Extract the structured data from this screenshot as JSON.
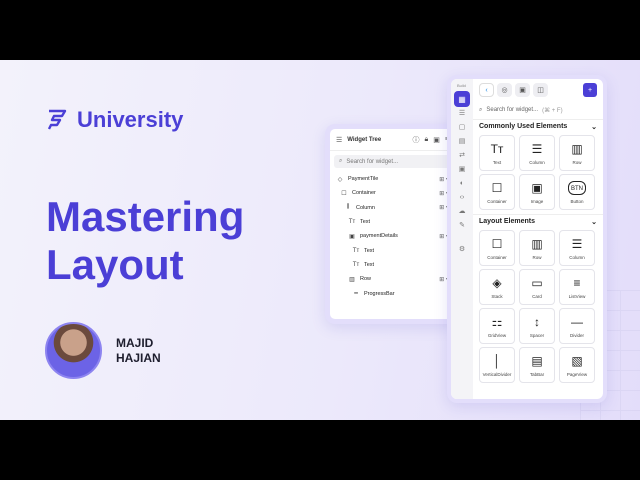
{
  "brand": {
    "name": "University",
    "logo": "university-logo"
  },
  "title": {
    "line1": "Mastering",
    "line2": "Layout"
  },
  "author": {
    "first": "MAJID",
    "last": "HAJIAN"
  },
  "colors": {
    "accent": "#4b3fd6",
    "background": "#ece9fb"
  },
  "tree": {
    "title": "Widget Tree",
    "search_placeholder": "Search for widget...",
    "rows": [
      {
        "label": "PaymentTile",
        "icon": "component-icon",
        "indent": 0,
        "action": true
      },
      {
        "label": "Container",
        "icon": "square-icon",
        "indent": 1,
        "action": true
      },
      {
        "label": "Column",
        "icon": "column-icon",
        "indent": 2,
        "action": true
      },
      {
        "label": "Text",
        "icon": "text-icon",
        "indent": 3,
        "action": false
      },
      {
        "label": "paymentDetails",
        "icon": "image-icon",
        "indent": 3,
        "action": true
      },
      {
        "label": "Text",
        "icon": "text-icon",
        "indent": 4,
        "action": false
      },
      {
        "label": "Text",
        "icon": "text-icon",
        "indent": 4,
        "action": false
      },
      {
        "label": "Row",
        "icon": "row-icon",
        "indent": 3,
        "action": true
      },
      {
        "label": "ProgressBar",
        "icon": "progress-icon",
        "indent": 4,
        "action": false
      }
    ]
  },
  "widgets": {
    "rail_label": "Build",
    "search_placeholder": "Search for widget...",
    "search_shortcut": "(⌘ + F)",
    "sections": [
      {
        "title": "Commonly Used Elements",
        "items": [
          {
            "label": "Text",
            "glyph": "Tт"
          },
          {
            "label": "Column",
            "glyph": "☰"
          },
          {
            "label": "Row",
            "glyph": "▥"
          },
          {
            "label": "Container",
            "glyph": "☐"
          },
          {
            "label": "Image",
            "glyph": "▣"
          },
          {
            "label": "Button",
            "glyph": "BTN"
          }
        ]
      },
      {
        "title": "Layout Elements",
        "items": [
          {
            "label": "Container",
            "glyph": "☐"
          },
          {
            "label": "Row",
            "glyph": "▥"
          },
          {
            "label": "Column",
            "glyph": "☰"
          },
          {
            "label": "Stack",
            "glyph": "◈"
          },
          {
            "label": "Card",
            "glyph": "▭"
          },
          {
            "label": "ListView",
            "glyph": "≡"
          },
          {
            "label": "GridView",
            "glyph": "⚏"
          },
          {
            "label": "Spacer",
            "glyph": "↕"
          },
          {
            "label": "Divider",
            "glyph": "—"
          },
          {
            "label": "VerticalDivider",
            "glyph": "│"
          },
          {
            "label": "TabBar",
            "glyph": "▤"
          },
          {
            "label": "PageView",
            "glyph": "▧"
          }
        ]
      }
    ]
  }
}
